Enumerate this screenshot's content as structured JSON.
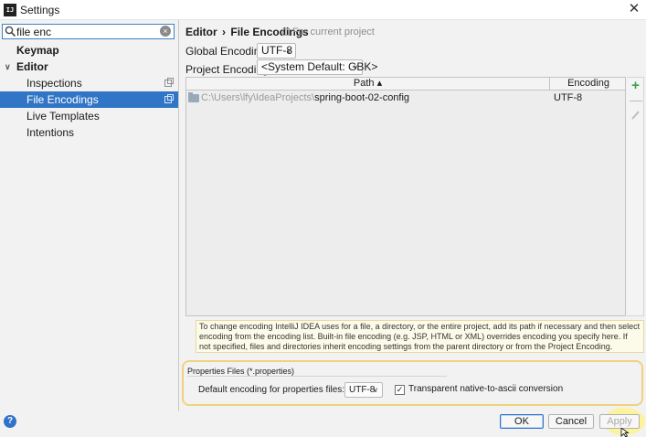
{
  "window": {
    "title": "Settings",
    "app_icon": "IJ"
  },
  "search": {
    "value": "file enc",
    "clear_glyph": "×"
  },
  "tree": {
    "items": [
      {
        "label": "Keymap"
      },
      {
        "label": "Editor",
        "arrow": "∨"
      },
      {
        "label": "Inspections"
      },
      {
        "label": "File Encodings"
      },
      {
        "label": "Live Templates"
      },
      {
        "label": "Intentions"
      }
    ]
  },
  "breadcrumb": {
    "parent": "Editor",
    "separator": "›",
    "current": "File Encodings",
    "scope": "For current project"
  },
  "form": {
    "global_label": "Global Encoding:",
    "global_value": "UTF-8",
    "project_label": "Project Encoding:",
    "project_value": "<System Default: GBK>"
  },
  "table": {
    "headers": {
      "path": "Path ▴",
      "encoding": "Encoding"
    },
    "rows": [
      {
        "path_dim": "C:\\Users\\lfy\\IdeaProjects\\",
        "path_name": "spring-boot-02-config",
        "encoding": "UTF-8"
      }
    ]
  },
  "toolbar": {
    "add": "+",
    "remove": "—"
  },
  "info": {
    "text": "To change encoding IntelliJ IDEA uses for a file, a directory, or the entire project, add its path if necessary and then select encoding from the encoding list. Built-in file encoding (e.g. JSP, HTML or XML) overrides encoding you specify here. If not specified, files and directories inherit encoding settings from the parent directory or from the Project Encoding."
  },
  "properties": {
    "legend": "Properties Files (*.properties)",
    "default_label": "Default encoding for properties files:",
    "default_value": "UTF-8",
    "transparent_label": "Transparent native-to-ascii conversion",
    "transparent_checked": true
  },
  "buttons": {
    "ok": "OK",
    "cancel": "Cancel",
    "apply": "Apply",
    "help": "?"
  },
  "colors": {
    "selection": "#3175c6",
    "add_green": "#3ea04a",
    "info_bg": "#fcfbe9",
    "highlight": "#f1d27c"
  },
  "icons": {
    "close": "close-icon",
    "search": "search-icon",
    "folder": "folder-icon",
    "edit": "pencil-icon",
    "help": "help-icon"
  }
}
